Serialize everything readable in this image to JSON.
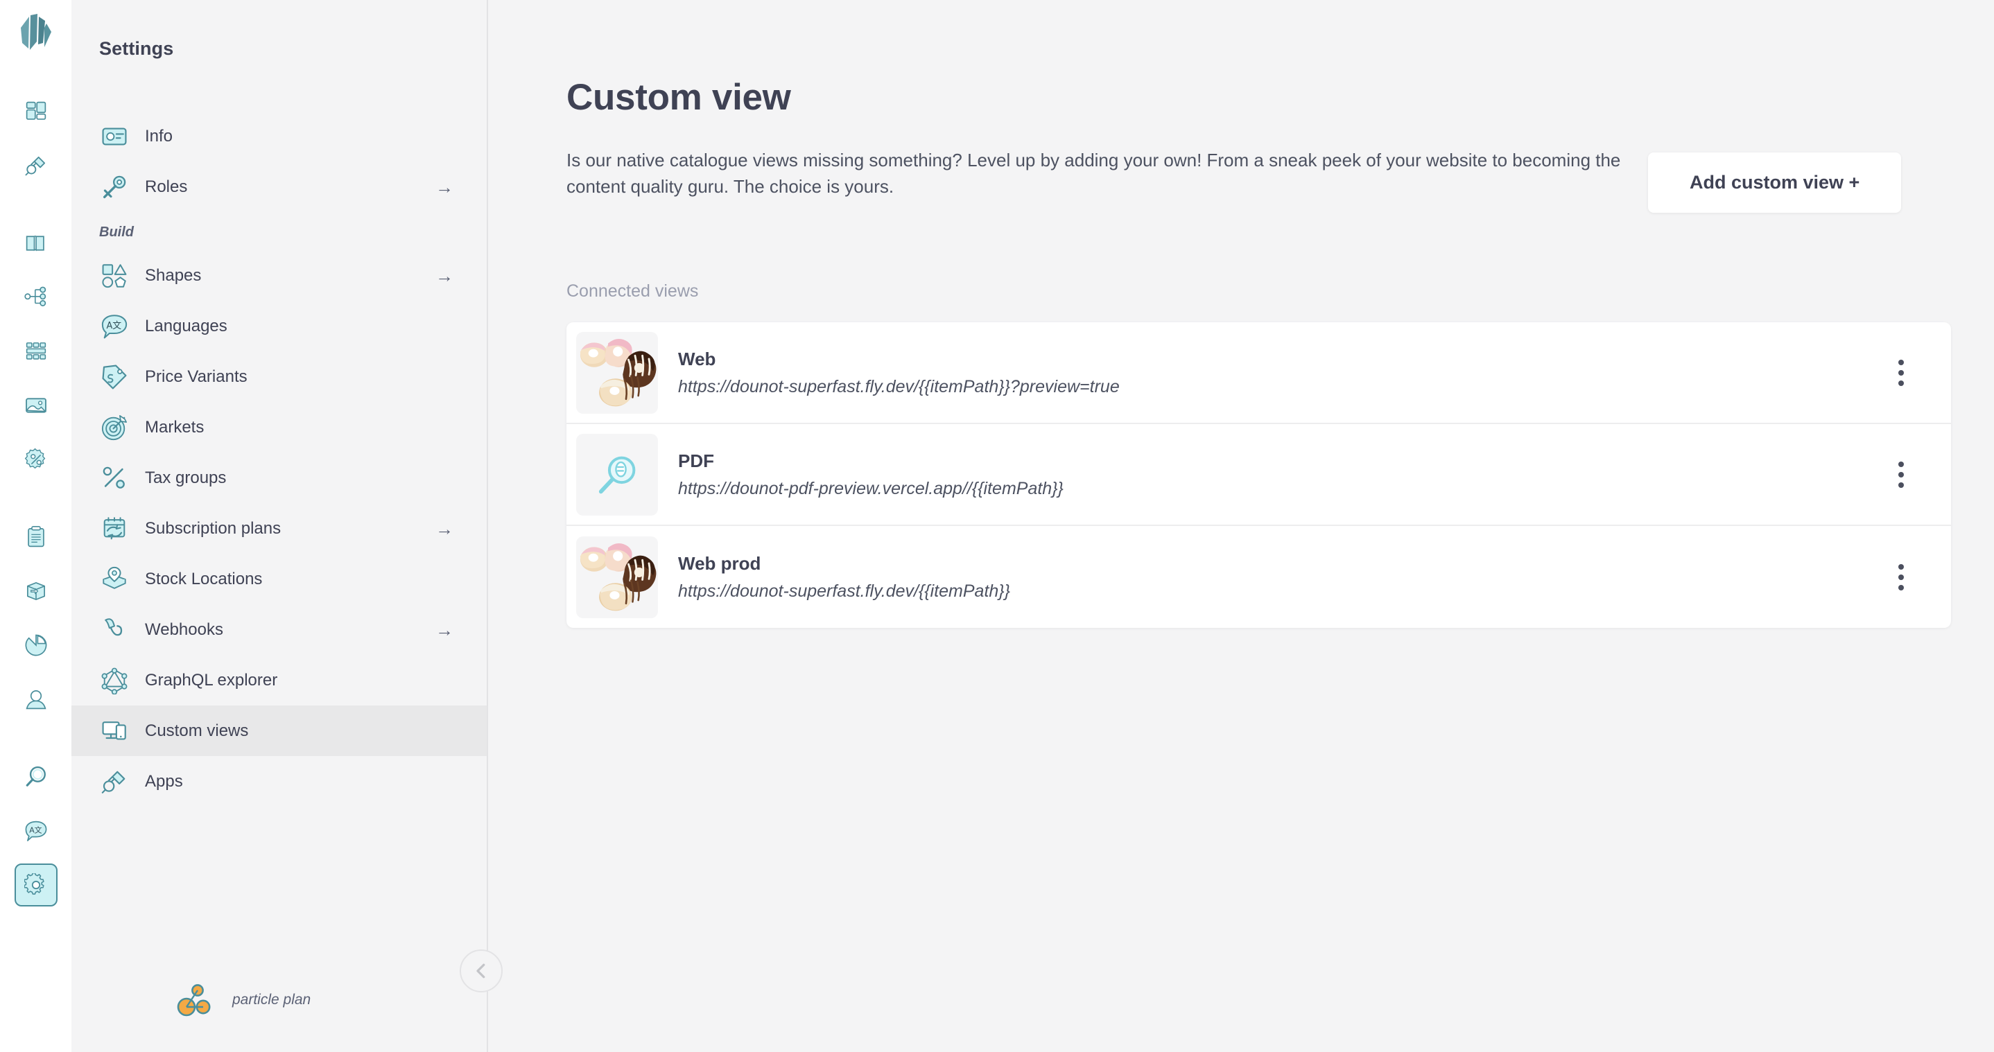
{
  "rail": {
    "logo_name": "crystallize-logo",
    "items": [
      {
        "icon": "dashboard-icon",
        "name": "rail-item-dashboard"
      },
      {
        "icon": "plug-icon",
        "name": "rail-item-apps"
      },
      {
        "icon": "catalogue-book-icon",
        "name": "rail-item-catalogue"
      },
      {
        "icon": "hierarchy-icon",
        "name": "rail-item-structure"
      },
      {
        "icon": "grid-blocks-icon",
        "name": "rail-item-grids"
      },
      {
        "icon": "image-icon",
        "name": "rail-item-media"
      },
      {
        "icon": "discount-icon",
        "name": "rail-item-discounts"
      },
      {
        "icon": "clipboard-icon",
        "name": "rail-item-orders"
      },
      {
        "icon": "box-arrow-icon",
        "name": "rail-item-shipments"
      },
      {
        "icon": "pie-chart-icon",
        "name": "rail-item-analytics"
      },
      {
        "icon": "user-icon",
        "name": "rail-item-customers"
      },
      {
        "icon": "search-icon",
        "name": "rail-item-search"
      },
      {
        "icon": "translate-icon",
        "name": "rail-item-translate"
      },
      {
        "icon": "gear-icon",
        "name": "rail-item-settings",
        "active": true
      }
    ]
  },
  "sidebar": {
    "title": "Settings",
    "top_items": [
      {
        "label": "Info",
        "icon": "id-card-icon",
        "arrow": ""
      },
      {
        "label": "Roles",
        "icon": "key-icon",
        "arrow": "→"
      }
    ],
    "section_label": "Build",
    "build_items": [
      {
        "label": "Shapes",
        "icon": "shapes-icon",
        "arrow": "→"
      },
      {
        "label": "Languages",
        "icon": "translate-icon",
        "arrow": ""
      },
      {
        "label": "Price Variants",
        "icon": "price-tag-icon",
        "arrow": ""
      },
      {
        "label": "Markets",
        "icon": "target-icon",
        "arrow": ""
      },
      {
        "label": "Tax groups",
        "icon": "percent-icon",
        "arrow": ""
      },
      {
        "label": "Subscription plans",
        "icon": "subscription-icon",
        "arrow": "→"
      },
      {
        "label": "Stock Locations",
        "icon": "stock-location-icon",
        "arrow": ""
      },
      {
        "label": "Webhooks",
        "icon": "webhook-icon",
        "arrow": "→"
      },
      {
        "label": "GraphQL explorer",
        "icon": "graphql-icon",
        "arrow": ""
      },
      {
        "label": "Custom views",
        "icon": "custom-views-icon",
        "arrow": "",
        "selected": true
      },
      {
        "label": "Apps",
        "icon": "plug-icon",
        "arrow": ""
      }
    ],
    "plan": {
      "label": "particle plan",
      "icon": "particle-icon"
    },
    "collapse_icon": "chevron-left-icon"
  },
  "main": {
    "title": "Custom view",
    "description": "Is our native catalogue views missing something? Level up by adding your own! From a sneak peek of your website to becoming the content quality guru. The choice is yours.",
    "add_button": "Add custom view +",
    "section_label": "Connected views",
    "views": [
      {
        "name": "Web",
        "url": "https://dounot-superfast.fly.dev/{{itemPath}}?preview=true",
        "thumb": "donuts-image",
        "menu_icon": "kebab-menu-icon"
      },
      {
        "name": "PDF",
        "url": "https://dounot-pdf-preview.vercel.app//{{itemPath}}",
        "thumb": "magnifier-image",
        "menu_icon": "kebab-menu-icon"
      },
      {
        "name": "Web prod",
        "url": "https://dounot-superfast.fly.dev/{{itemPath}}",
        "thumb": "donuts-image",
        "menu_icon": "kebab-menu-icon"
      }
    ]
  },
  "colors": {
    "accent_teal": "#4a8e9b",
    "icon_fill": "#cdf1f4",
    "text_dark": "#3f4254",
    "text_muted": "#9a9eae",
    "page_bg": "#f4f4f5",
    "card_bg": "#ffffff",
    "plan_orange": "#f5a944"
  }
}
